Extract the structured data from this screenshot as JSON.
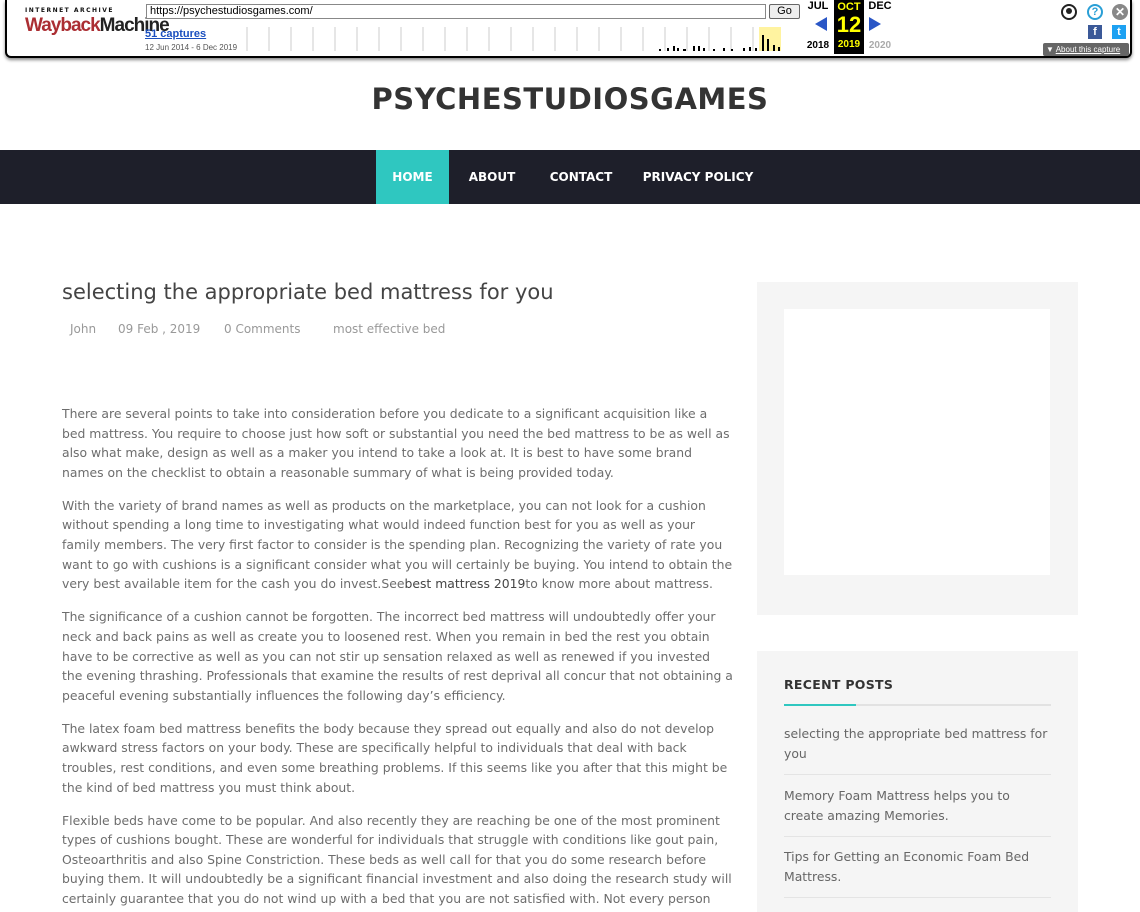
{
  "wayback": {
    "logo_top": "INTERNET ARCHIVE",
    "logo_word1": "Wayback",
    "logo_word2": "Machine",
    "url": "https://psychestudiosgames.com/",
    "go_label": "Go",
    "captures_link": "51 captures",
    "date_range": "12 Jun 2014 - 6 Dec 2019",
    "prev_month": "JUL",
    "current_month": "OCT",
    "next_month": "DEC",
    "current_day": "12",
    "prev_year": "2018",
    "current_year": "2019",
    "next_year": "2020",
    "about_label": "About this capture",
    "fb_glyph": "f",
    "tw_glyph": "t",
    "help_glyph": "?",
    "close_glyph": "✕"
  },
  "site": {
    "title": "PSYCHESTUDIOSGAMES"
  },
  "nav": {
    "items": [
      {
        "label": "HOME",
        "active": true
      },
      {
        "label": "ABOUT",
        "active": false
      },
      {
        "label": "CONTACT",
        "active": false
      },
      {
        "label": "PRIVACY POLICY",
        "active": false
      }
    ]
  },
  "post": {
    "title": "selecting the appropriate bed mattress for you",
    "author": "John",
    "date": "09 Feb , 2019",
    "comments": "0 Comments",
    "category": "most effective bed",
    "paragraphs": [
      "There are several points to take into consideration before you dedicate to a significant acquisition like a bed mattress. You require to choose just how soft or substantial you need the bed mattress to be as well as also what make, design as well as a maker you intend to take a look at. It is best to have some brand names on the checklist to obtain a reasonable summary of what is being provided today.",
      "With the variety of brand names as well as products on the marketplace, you can not look for a cushion without spending a long time to investigating what would indeed function best for you as well as your family members. The very first factor to consider is the spending plan. Recognizing the variety of rate you want to go with cushions is a significant consider what you will certainly be buying. You intend to obtain the very best available item for the cash you do invest.See",
      "The significance of a cushion cannot be forgotten. The incorrect bed mattress will undoubtedly offer your neck and back pains as well as create you to loosened rest. When you remain in bed the rest you obtain have to be corrective as well as you can not stir up sensation relaxed as well as renewed if you invested the evening thrashing. Professionals that examine the results of rest deprival all concur that not obtaining a peaceful evening substantially influences the following day’s efficiency.",
      "The latex foam bed mattress benefits the body because they spread out equally and also do not develop awkward stress factors on your body. These are specifically helpful to individuals that deal with back troubles, rest conditions, and even some breathing problems. If this seems like you after that this might be the kind of bed mattress you must think about.",
      "Flexible beds have come to be popular. And also recently they are reaching be one of the most prominent types of cushions bought. These are wonderful for individuals that struggle with conditions like gout pain, Osteoarthritis and also Spine Constriction. These beds as well call for that you do some research before buying them. It will undoubtedly be a significant financial investment and also doing the research study will certainly guarantee that you do not wind up with a bed that you are not satisfied with. Not every person"
    ],
    "link_text": "best mattress 2019",
    "link_after": "to know more about mattress."
  },
  "sidebar": {
    "recent_title": "RECENT POSTS",
    "recent": [
      "selecting the appropriate bed mattress for you",
      "Memory Foam Mattress helps you to create amazing Memories.",
      "Tips for Getting an Economic Foam Bed Mattress."
    ]
  },
  "colors": {
    "accent": "#2fc7c0",
    "nav_bg": "#1e1f2a",
    "wayback_red": "#ab2e33"
  }
}
